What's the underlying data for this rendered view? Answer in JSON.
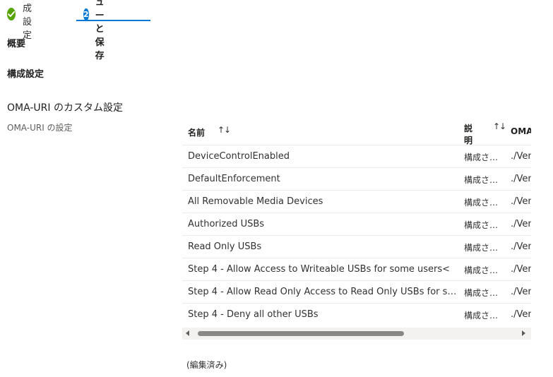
{
  "wizard": {
    "steps": [
      {
        "label": "構成設定",
        "state": "complete",
        "icon": "checkmark-icon"
      },
      {
        "label": "レビューと保存",
        "state": "active",
        "number": "2"
      }
    ]
  },
  "sections": {
    "overview": "概要",
    "config": "構成設定",
    "custom_heading": "OMA-URI のカスタム設定",
    "settings_label": "OMA-URI の設定"
  },
  "table": {
    "columns": {
      "name": "名前",
      "description": "説明",
      "oma": "OMA"
    },
    "sort_icon": "↑↓",
    "rows": [
      {
        "name": "DeviceControlEnabled",
        "desc": "構成さ…",
        "oma": "./Ven"
      },
      {
        "name": "DefaultEnforcement",
        "desc": "構成さ…",
        "oma": "./Ven"
      },
      {
        "name": "All Removable Media Devices",
        "desc": "構成さ…",
        "oma": "./Ven"
      },
      {
        "name": "Authorized USBs",
        "desc": "構成さ…",
        "oma": "./Ven"
      },
      {
        "name": "Read Only USBs",
        "desc": "構成さ…",
        "oma": "./Ven"
      },
      {
        "name": "Step 4 - Allow Access to Writeable USBs for some users<",
        "desc": "構成さ…",
        "oma": "./Ven"
      },
      {
        "name": "Step 4 - Allow Read Only Access to Read Only USBs for so…",
        "desc": "構成さ…",
        "oma": "./Ven"
      },
      {
        "name": "Step 4 - Deny all other USBs",
        "desc": "構成さ…",
        "oma": "./Ven"
      }
    ]
  },
  "footer": {
    "edited": "(編集済み)"
  },
  "colors": {
    "accent": "#0078d4",
    "success": "#57a300"
  }
}
